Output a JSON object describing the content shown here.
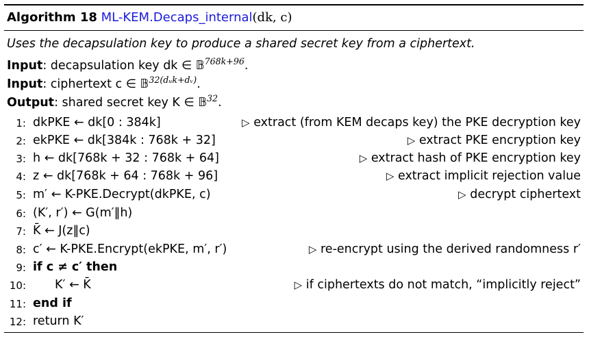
{
  "algorithm": {
    "label": "Algorithm 18",
    "name": "ML-KEM.Decaps_internal",
    "args": "(dk, c)"
  },
  "description": "Uses the decapsulation key to produce a shared secret key from a ciphertext.",
  "inputs": [
    {
      "label": "Input",
      "text": ": decapsulation key dk ∈ 𝔹",
      "sup": "768k+96",
      "tail": "."
    },
    {
      "label": "Input",
      "text": ": ciphertext c ∈ 𝔹",
      "sup": "32(dᵤk+dᵥ)",
      "tail": "."
    },
    {
      "label": "Output",
      "text": ": shared secret key K ∈ 𝔹",
      "sup": "32",
      "tail": "."
    }
  ],
  "lines": [
    {
      "num": "1:",
      "code": "dkPKE ← dk[0 : 384k]",
      "comment": "extract (from KEM decaps key) the PKE decryption key"
    },
    {
      "num": "2:",
      "code": "ekPKE ← dk[384k : 768k + 32]",
      "comment": "extract PKE encryption key"
    },
    {
      "num": "3:",
      "code": "h ← dk[768k + 32 : 768k + 64]",
      "comment": "extract hash of PKE encryption key"
    },
    {
      "num": "4:",
      "code": "z ← dk[768k + 64 : 768k + 96]",
      "comment": "extract implicit rejection value"
    },
    {
      "num": "5:",
      "code": "m′ ← K-PKE.Decrypt(dkPKE, c)",
      "comment": "decrypt ciphertext"
    },
    {
      "num": "6:",
      "code": "(K′, r′) ← G(m′‖h)",
      "comment": ""
    },
    {
      "num": "7:",
      "code": "K̄ ← J(z‖c)",
      "comment": ""
    },
    {
      "num": "8:",
      "code": "c′ ← K-PKE.Encrypt(ekPKE, m′, r′)",
      "comment": "re-encrypt using the derived randomness r′"
    },
    {
      "num": "9:",
      "code": "if c ≠ c′ then",
      "comment": ""
    },
    {
      "num": "10:",
      "code": "K′ ← K̄",
      "comment": "if ciphertexts do not match, “implicitly reject”"
    },
    {
      "num": "11:",
      "code": "end if",
      "comment": ""
    },
    {
      "num": "12:",
      "code": "return K′",
      "comment": ""
    }
  ],
  "comment_marker": "▷",
  "colors": {
    "keyword_blue": "#1a1adc",
    "text": "#000000"
  }
}
